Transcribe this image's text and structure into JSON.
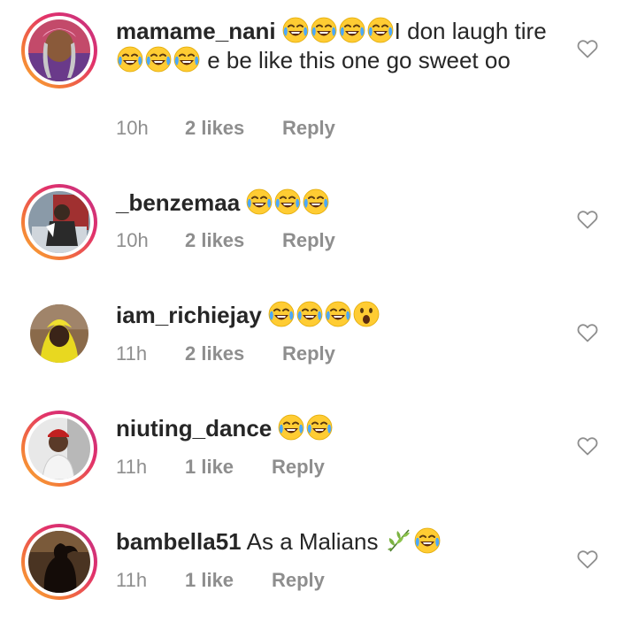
{
  "comments": [
    {
      "username": "mamame_nani",
      "text_a": "I don laugh tire",
      "text_b": "e be like this one go sweet oo",
      "time": "10h",
      "likes": "2 likes",
      "reply": "Reply",
      "story_ring": true,
      "emojis_a": [
        "face-with-tears-of-joy",
        "face-with-tears-of-joy",
        "face-with-tears-of-joy",
        "face-with-tears-of-joy"
      ],
      "emojis_b": [
        "face-with-tears-of-joy",
        "face-with-tears-of-joy",
        "face-with-tears-of-joy"
      ]
    },
    {
      "username": "_benzemaa",
      "text_a": "",
      "time": "10h",
      "likes": "2 likes",
      "reply": "Reply",
      "story_ring": true,
      "emojis_a": [
        "face-with-tears-of-joy",
        "face-with-tears-of-joy",
        "face-with-tears-of-joy"
      ]
    },
    {
      "username": "iam_richiejay",
      "text_a": "",
      "time": "11h",
      "likes": "2 likes",
      "reply": "Reply",
      "story_ring": false,
      "emojis_a": [
        "face-with-tears-of-joy",
        "face-with-tears-of-joy",
        "face-with-tears-of-joy",
        "face-with-open-mouth"
      ]
    },
    {
      "username": "niuting_dance",
      "text_a": "",
      "time": "11h",
      "likes": "1 like",
      "reply": "Reply",
      "story_ring": true,
      "emojis_a": [
        "face-with-tears-of-joy",
        "face-with-tears-of-joy"
      ]
    },
    {
      "username": "bambella51",
      "text_a": "As a Malians",
      "time": "11h",
      "likes": "1 like",
      "reply": "Reply",
      "story_ring": true,
      "emojis_a": [
        "herb",
        "face-with-tears-of-joy"
      ]
    }
  ],
  "icons": {
    "like": "heart-outline-icon"
  },
  "colors": {
    "text": "#262626",
    "meta": "#8e8e8e",
    "story_ring_start": "#f9b233",
    "story_ring_end": "#c13584"
  }
}
